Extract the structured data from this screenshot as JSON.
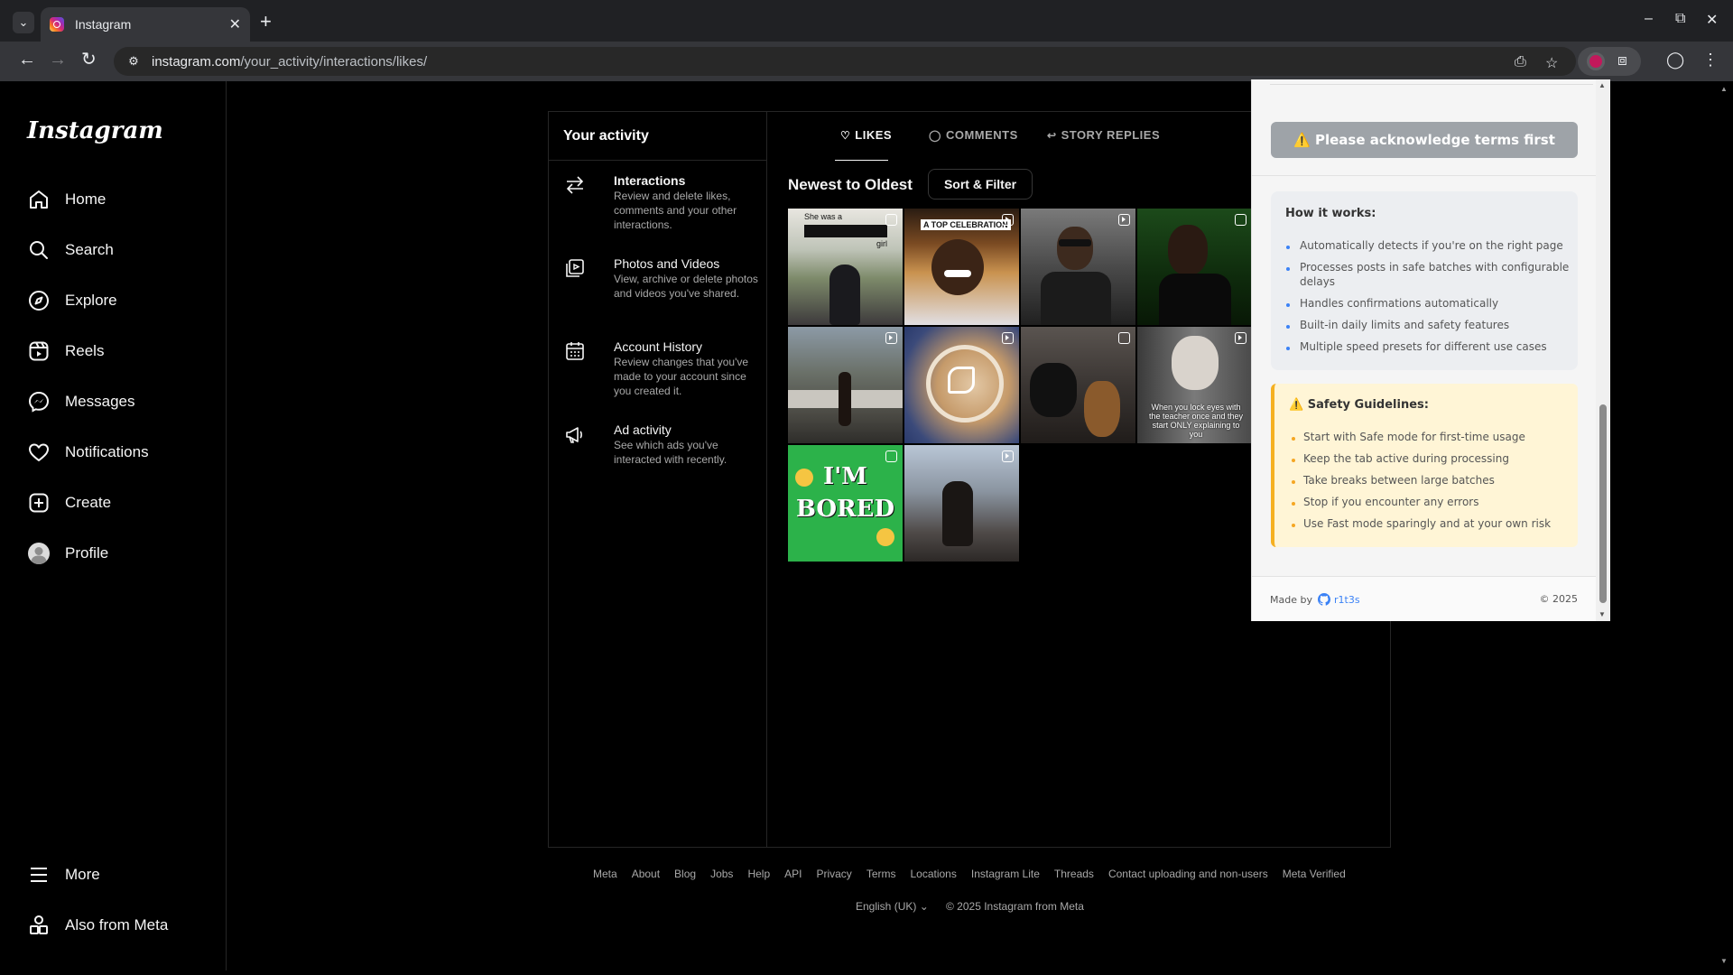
{
  "browser": {
    "tab_title": "Instagram",
    "url_host": "instagram.com",
    "url_path": "/your_activity/interactions/likes/"
  },
  "sidebar": {
    "logo": "Instagram",
    "items": [
      {
        "label": "Home",
        "icon": "home-icon"
      },
      {
        "label": "Search",
        "icon": "search-icon"
      },
      {
        "label": "Explore",
        "icon": "compass-icon"
      },
      {
        "label": "Reels",
        "icon": "reels-icon"
      },
      {
        "label": "Messages",
        "icon": "messenger-icon"
      },
      {
        "label": "Notifications",
        "icon": "heart-icon"
      },
      {
        "label": "Create",
        "icon": "plus-square-icon"
      },
      {
        "label": "Profile",
        "icon": "avatar-icon"
      }
    ],
    "more": "More",
    "also_from_meta": "Also from Meta"
  },
  "activity": {
    "title": "Your activity",
    "items": [
      {
        "name": "Interactions",
        "desc": "Review and delete likes, comments and your other interactions."
      },
      {
        "name": "Photos and Videos",
        "desc": "View, archive or delete photos and videos you've shared."
      },
      {
        "name": "Account History",
        "desc": "Review changes that you've made to your account since you created it."
      },
      {
        "name": "Ad activity",
        "desc": "See which ads you've interacted with recently."
      }
    ],
    "tabs": [
      "LIKES",
      "COMMENTS",
      "STORY REPLIES"
    ],
    "sort_label": "Newest to Oldest",
    "sort_button": "Sort & Filter",
    "thumb_captions": {
      "t1": "She was a",
      "t1b": "girl",
      "t2": "A TOP CELEBRATION",
      "t8": "When you lock eyes with the teacher once and they start ONLY explaining to you",
      "t9a": "I'M",
      "t9b": "BORED"
    }
  },
  "footer": {
    "links": [
      "Meta",
      "About",
      "Blog",
      "Jobs",
      "Help",
      "API",
      "Privacy",
      "Terms",
      "Locations",
      "Instagram Lite",
      "Threads",
      "Contact uploading and non-users",
      "Meta Verified"
    ],
    "language": "English (UK)",
    "copyright": "© 2025 Instagram from Meta"
  },
  "popup": {
    "ack_button": "⚠️ Please acknowledge terms first",
    "how_title": "How it works:",
    "how_items": [
      "Automatically detects if you're on the right page",
      "Processes posts in safe batches with configurable delays",
      "Handles confirmations automatically",
      "Built-in daily limits and safety features",
      "Multiple speed presets for different use cases"
    ],
    "safety_title": "⚠️ Safety Guidelines:",
    "safety_items": [
      "Start with Safe mode for first-time usage",
      "Keep the tab active during processing",
      "Take breaks between large batches",
      "Stop if you encounter any errors",
      "Use Fast mode sparingly and at your own risk"
    ],
    "made_by": "Made by",
    "author": "r1t3s",
    "copyright": "© 2025"
  }
}
